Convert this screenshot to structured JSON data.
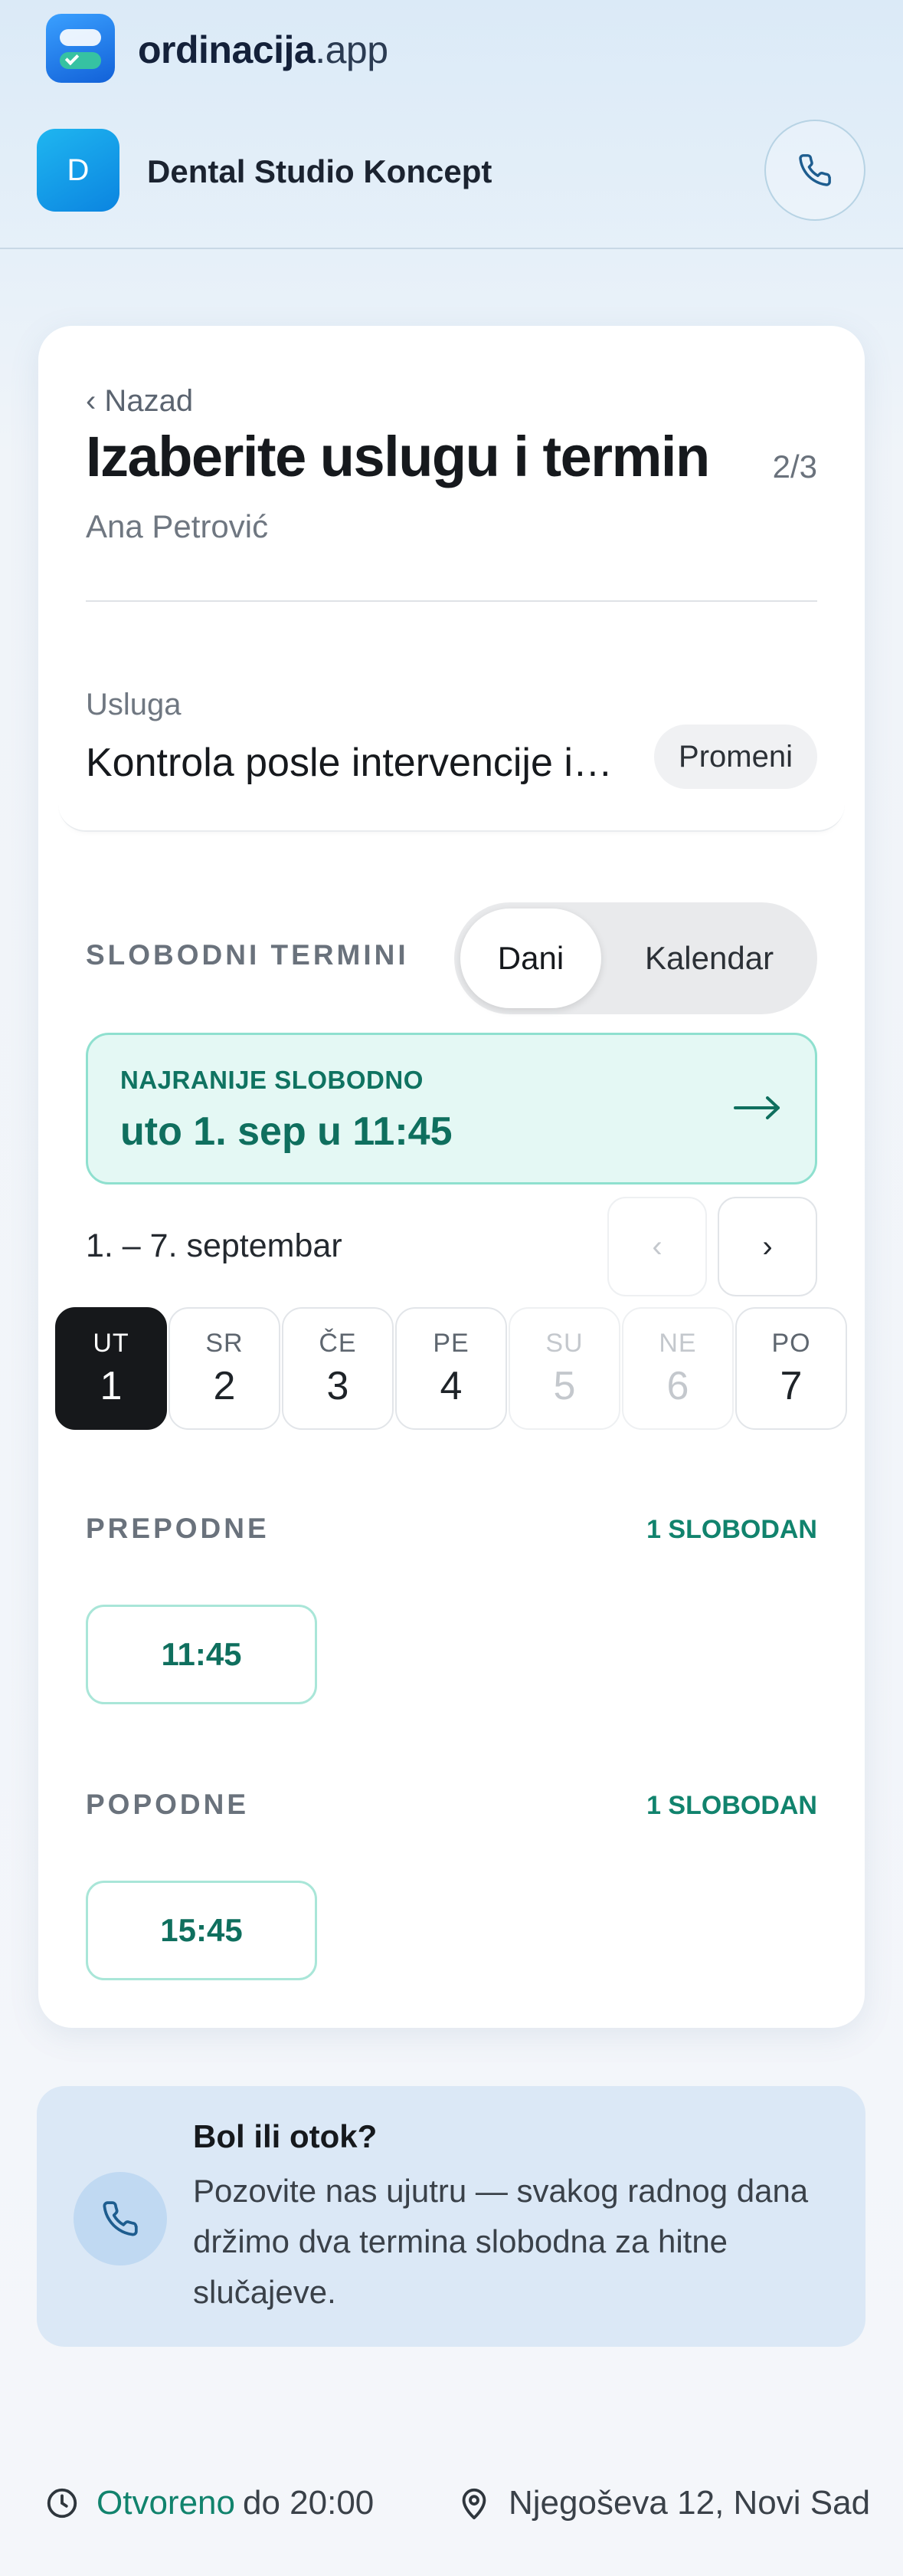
{
  "app": {
    "name_bold": "ordinacija",
    "name_light": ".app",
    "logo_icon": "app-logo-icon"
  },
  "clinic": {
    "avatar_letter": "D",
    "name": "Dental Studio Koncept",
    "phone_icon": "phone-icon"
  },
  "booking": {
    "back_label": "‹ Nazad",
    "title": "Izaberite uslugu i termin",
    "step": "2/3",
    "patient": "Ana Petrović"
  },
  "service": {
    "label": "Usluga",
    "value": "Kontrola posle intervencije ili lečenja",
    "change_label": "Promeni"
  },
  "slots": {
    "label": "SLOBODNI TERMINI",
    "view_toggle": {
      "options": [
        "Dani",
        "Kalendar"
      ],
      "selected": "Dani"
    },
    "earliest": {
      "caption": "NAJRANIJE SLOBODNO",
      "value": "uto 1. sep u 11:45"
    },
    "range": "1. – 7. septembar",
    "prev_label": "‹",
    "next_label": "›",
    "days": [
      {
        "name": "UT",
        "date": "1",
        "state": "selected"
      },
      {
        "name": "SR",
        "date": "2",
        "state": "available"
      },
      {
        "name": "ČE",
        "date": "3",
        "state": "available"
      },
      {
        "name": "PE",
        "date": "4",
        "state": "available"
      },
      {
        "name": "SU",
        "date": "5",
        "state": "disabled"
      },
      {
        "name": "NE",
        "date": "6",
        "state": "disabled"
      },
      {
        "name": "PO",
        "date": "7",
        "state": "available"
      }
    ],
    "periods": [
      {
        "label": "PREPODNE",
        "count": "1 SLOBODAN",
        "times": [
          "11:45"
        ]
      },
      {
        "label": "POPODNE",
        "count": "1 SLOBODAN",
        "times": [
          "15:45"
        ]
      }
    ]
  },
  "emergency": {
    "title": "Bol ili otok?",
    "text": "Pozovite nas ujutru — svakog radnog dana držimo dva termina slobodna za hitne slučajeve."
  },
  "footer": {
    "open_label": "Otvoreno",
    "until_label": "do 20:00",
    "address": "Njegoševa 12, Novi Sad"
  },
  "colors": {
    "accent_green": "#11836d",
    "earliest_bg": "#e4f8f4",
    "selected_day": "#16181b",
    "emergency_bg": "#dbe8f6"
  }
}
